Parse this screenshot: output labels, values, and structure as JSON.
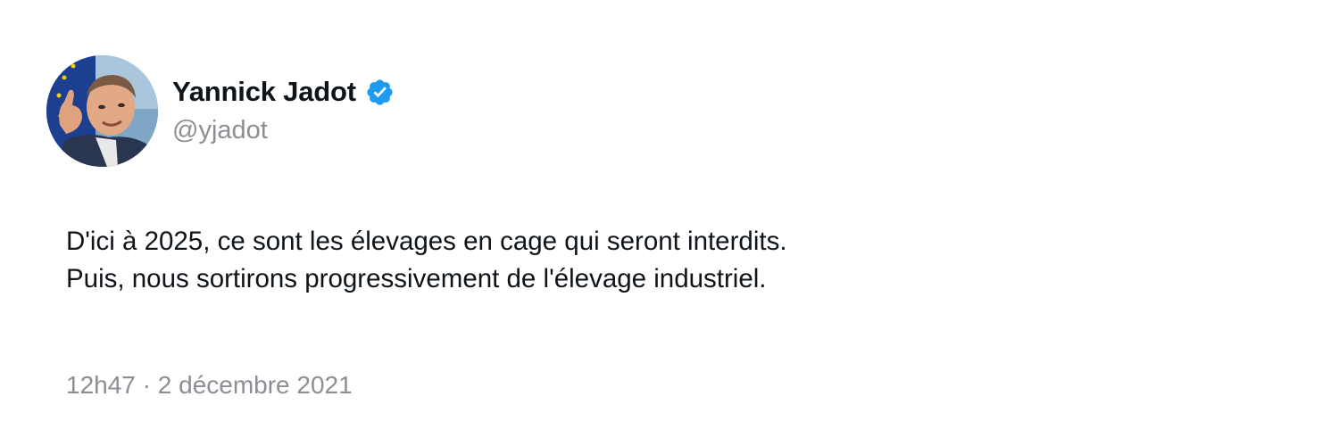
{
  "tweet": {
    "author": {
      "display_name": "Yannick Jadot",
      "handle": "@yjadot",
      "verified_icon": "verified-badge-icon",
      "verified_color": "#1d9bf0"
    },
    "text_lines": [
      "D'ici à 2025, ce sont les élevages en cage qui seront interdits.",
      "Puis, nous sortirons progressivement de l'élevage industriel."
    ],
    "meta": {
      "time": "12h47",
      "separator": "·",
      "date": "2 décembre 2021"
    }
  }
}
